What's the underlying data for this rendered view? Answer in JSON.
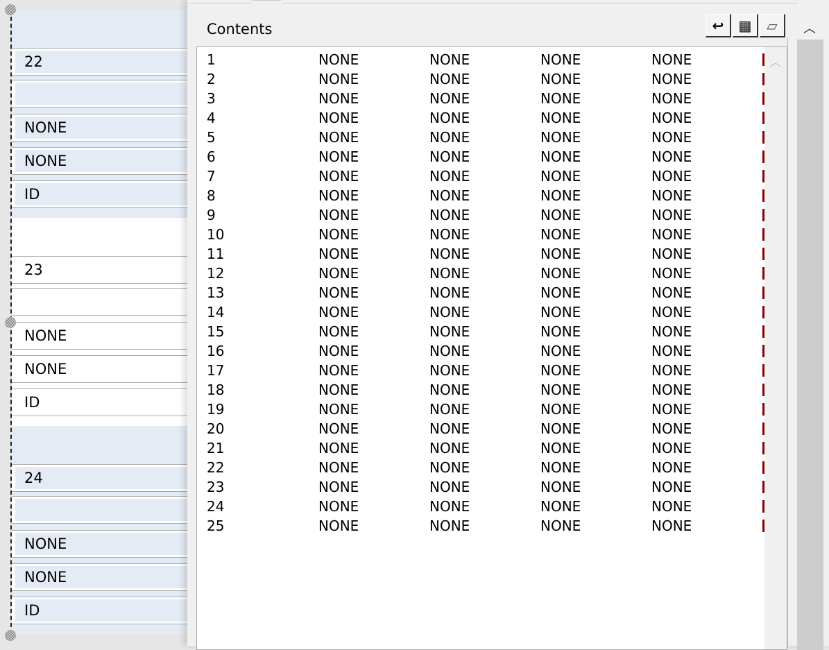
{
  "records": [
    {
      "id": "22",
      "fields": [
        "",
        "NONE",
        "NONE",
        "ID"
      ]
    },
    {
      "id": "23",
      "fields": [
        "",
        "NONE",
        "NONE",
        "ID"
      ]
    },
    {
      "id": "24",
      "fields": [
        "",
        "NONE",
        "NONE",
        "ID"
      ]
    }
  ],
  "panel": {
    "title": "Contents",
    "toolbar": {
      "icons": [
        "wrap-icon",
        "grid-icon",
        "folder-icon"
      ]
    },
    "rows": [
      [
        "1",
        "NONE",
        "NONE",
        "NONE",
        "NONE"
      ],
      [
        "2",
        "NONE",
        "NONE",
        "NONE",
        "NONE"
      ],
      [
        "3",
        "NONE",
        "NONE",
        "NONE",
        "NONE"
      ],
      [
        "4",
        "NONE",
        "NONE",
        "NONE",
        "NONE"
      ],
      [
        "5",
        "NONE",
        "NONE",
        "NONE",
        "NONE"
      ],
      [
        "6",
        "NONE",
        "NONE",
        "NONE",
        "NONE"
      ],
      [
        "7",
        "NONE",
        "NONE",
        "NONE",
        "NONE"
      ],
      [
        "8",
        "NONE",
        "NONE",
        "NONE",
        "NONE"
      ],
      [
        "9",
        "NONE",
        "NONE",
        "NONE",
        "NONE"
      ],
      [
        "10",
        "NONE",
        "NONE",
        "NONE",
        "NONE"
      ],
      [
        "11",
        "NONE",
        "NONE",
        "NONE",
        "NONE"
      ],
      [
        "12",
        "NONE",
        "NONE",
        "NONE",
        "NONE"
      ],
      [
        "13",
        "NONE",
        "NONE",
        "NONE",
        "NONE"
      ],
      [
        "14",
        "NONE",
        "NONE",
        "NONE",
        "NONE"
      ],
      [
        "15",
        "NONE",
        "NONE",
        "NONE",
        "NONE"
      ],
      [
        "16",
        "NONE",
        "NONE",
        "NONE",
        "NONE"
      ],
      [
        "17",
        "NONE",
        "NONE",
        "NONE",
        "NONE"
      ],
      [
        "18",
        "NONE",
        "NONE",
        "NONE",
        "NONE"
      ],
      [
        "19",
        "NONE",
        "NONE",
        "NONE",
        "NONE"
      ],
      [
        "20",
        "NONE",
        "NONE",
        "NONE",
        "NONE"
      ],
      [
        "21",
        "NONE",
        "NONE",
        "NONE",
        "NONE"
      ],
      [
        "22",
        "NONE",
        "NONE",
        "NONE",
        "NONE"
      ],
      [
        "23",
        "NONE",
        "NONE",
        "NONE",
        "NONE"
      ],
      [
        "24",
        "NONE",
        "NONE",
        "NONE",
        "NONE"
      ],
      [
        "25",
        "NONE",
        "NONE",
        "NONE",
        "NONE"
      ]
    ]
  },
  "colors": {
    "record_alt": "#e4ebf5",
    "clipped_marker": "#8b0000"
  }
}
